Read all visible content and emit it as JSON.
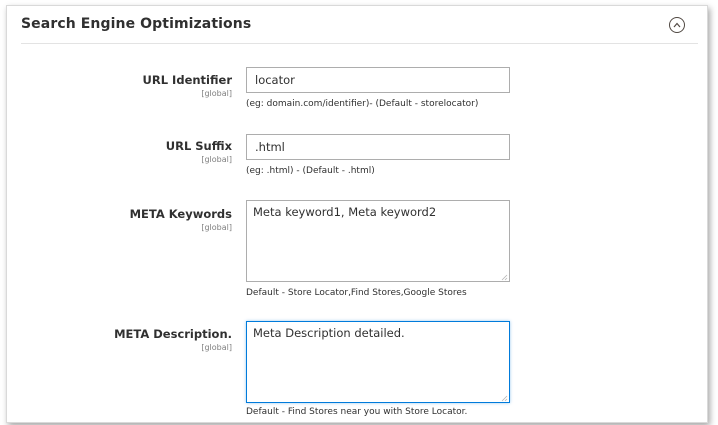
{
  "section": {
    "title": "Search Engine Optimizations"
  },
  "fields": {
    "url_identifier": {
      "label": "URL Identifier",
      "scope": "[global]",
      "value": "locator",
      "note": "(eg: domain.com/identifier)- (Default - storelocator)"
    },
    "url_suffix": {
      "label": "URL Suffix",
      "scope": "[global]",
      "value": ".html",
      "note": "(eg: .html) - (Default - .html)"
    },
    "meta_keywords": {
      "label": "META Keywords",
      "scope": "[global]",
      "value": "Meta keyword1, Meta keyword2",
      "note": "Default - Store Locator,Find Stores,Google Stores"
    },
    "meta_description": {
      "label": "META Description.",
      "scope": "[global]",
      "value": "Meta Description detailed.",
      "note": "Default - Find Stores near you with Store Locator."
    }
  },
  "icons": {
    "collapse": "chevron-up-circle-icon",
    "resize": "resize-grip-icon"
  },
  "colors": {
    "focus_border": "#007bdb",
    "input_border": "#adadad",
    "text": "#303030"
  }
}
